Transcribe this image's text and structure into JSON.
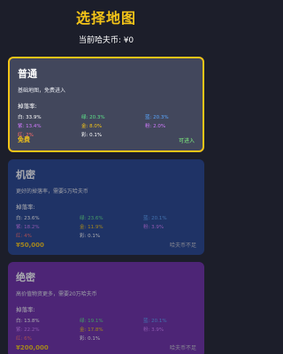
{
  "header": {
    "title": "选择地图",
    "balance": "当前哈夫币: ¥0"
  },
  "drop_label": "掉落率:",
  "colors": {
    "gold": "#f5c518",
    "ok": "#7ff07f",
    "white": "#ffffff",
    "green": "#5de28a",
    "blue": "#5aa6ff",
    "purple": "#d27bff",
    "gold_rate": "#f5c518",
    "red": "#ff6b6b"
  },
  "maps": [
    {
      "name": "普通",
      "desc": "基础地图，免费进入",
      "rates": [
        "白: 33.9%",
        "绿: 20.3%",
        "蓝: 20.3%",
        "紫: 13.4%",
        "金: 8.0%",
        "粉: 2.0%",
        "红: 2%",
        "彩: 0.1%"
      ],
      "price": "免费",
      "status": "可进入"
    },
    {
      "name": "机密",
      "desc": "更好的掉落率，需要5万哈夫币",
      "rates": [
        "白: 23.6%",
        "绿: 23.6%",
        "蓝: 20.1%",
        "紫: 18.2%",
        "金: 11.9%",
        "粉: 3.9%",
        "红: 4%",
        "彩: 0.1%"
      ],
      "price": "¥50,000",
      "status": "哈夫币不足"
    },
    {
      "name": "绝密",
      "desc": "高价值物资更多，需要20万哈夫币",
      "rates": [
        "白: 13.8%",
        "绿: 19.1%",
        "蓝: 20.1%",
        "紫: 22.2%",
        "金: 17.8%",
        "粉: 3.9%",
        "红: 6%",
        "彩: 0.1%"
      ],
      "price": "¥200,000",
      "status": "哈夫币不足"
    }
  ]
}
